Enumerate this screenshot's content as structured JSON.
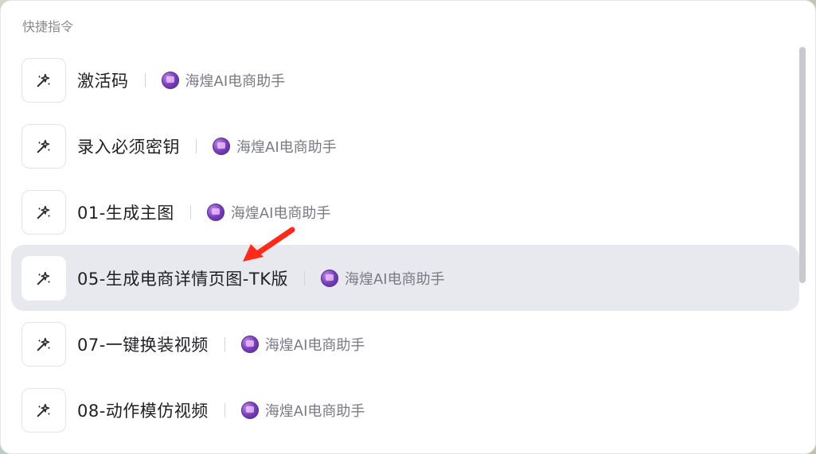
{
  "panel": {
    "title": "快捷指令"
  },
  "shortcuts": [
    {
      "name": "激活码",
      "bot": "海煌AI电商助手",
      "icon": "sparkle-wand-icon",
      "active": false
    },
    {
      "name": "录入必须密钥",
      "bot": "海煌AI电商助手",
      "icon": "sparkle-wand-icon",
      "active": false
    },
    {
      "name": "01-生成主图",
      "bot": "海煌AI电商助手",
      "icon": "sparkle-wand-icon",
      "active": false
    },
    {
      "name": "05-生成电商详情页图-TK版",
      "bot": "海煌AI电商助手",
      "icon": "sparkle-wand-icon",
      "active": true
    },
    {
      "name": "07-一键换装视频",
      "bot": "海煌AI电商助手",
      "icon": "sparkle-wand-icon",
      "active": false
    },
    {
      "name": "08-动作模仿视频",
      "bot": "海煌AI电商助手",
      "icon": "sparkle-wand-icon",
      "active": false
    }
  ],
  "colors": {
    "active_bg": "#e8e9ef",
    "arrow": "#ff2a1a",
    "title_text": "#8a8a93",
    "item_text": "#1f1f24",
    "bot_text": "#7a7a85"
  }
}
